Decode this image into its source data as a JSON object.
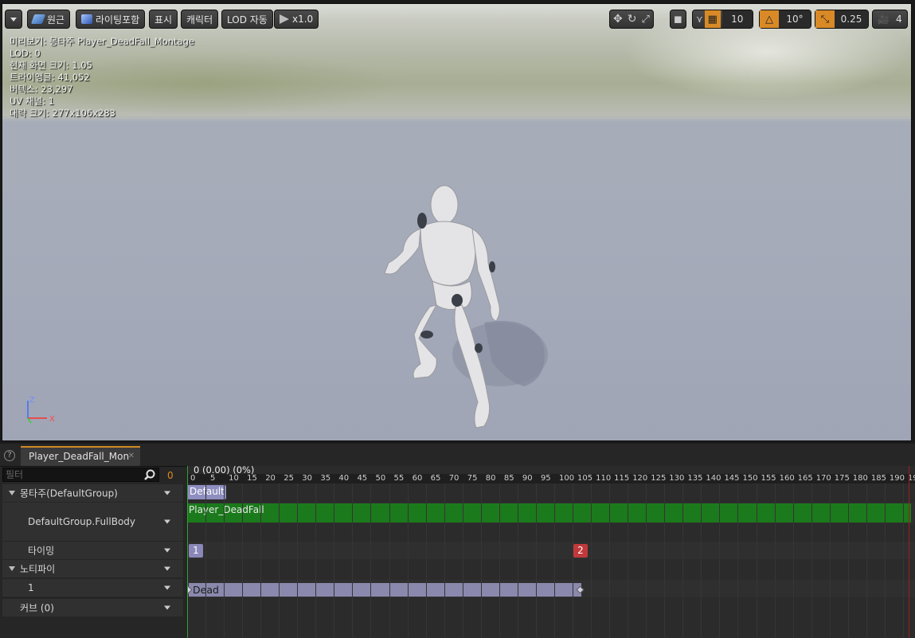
{
  "toolbar": {
    "dropdown_icon": "chevron-down-icon",
    "perspective": "원근",
    "lighting": "라이팅포함",
    "show": "표시",
    "character": "캐릭터",
    "lod": "LOD 자동",
    "speed": "x1.0",
    "grid_snap": "10",
    "rotation_snap": "10°",
    "scale_snap": "0.25",
    "camera_speed": "4",
    "colors": {
      "orange": "#d98a27"
    }
  },
  "stats": {
    "preview": "미리보기: 몽타주 Player_DeadFall_Montage",
    "lod": "LOD: 0",
    "screen_size": "현재 화면 크기: 1.05",
    "triangles": "트라이앵글: 41,052",
    "vertices": "버텍스: 23,297",
    "uv": "UV 채널: 1",
    "bounds": "대략 크기: 277x106x283"
  },
  "axis": {
    "z": "Z",
    "x": "X"
  },
  "panel": {
    "tab_label": "Player_DeadFall_Mon",
    "filter_placeholder": "필터",
    "filter_count": "0",
    "tracks": [
      {
        "label": "몽타주(DefaultGroup)"
      },
      {
        "label": "DefaultGroup.FullBody"
      },
      {
        "label": "타이밍"
      },
      {
        "label": "노티파이"
      },
      {
        "label": "1"
      },
      {
        "label": "커브  (0)"
      }
    ]
  },
  "timeline": {
    "current_time": "0 (0.00) (0%)",
    "ticks": [
      "0",
      "5",
      "10",
      "15",
      "20",
      "25",
      "30",
      "35",
      "40",
      "45",
      "50",
      "55",
      "60",
      "65",
      "70",
      "75",
      "80",
      "85",
      "90",
      "95",
      "100",
      "105",
      "110",
      "115",
      "120",
      "125",
      "130",
      "135",
      "140",
      "145",
      "150",
      "155",
      "160",
      "165",
      "170",
      "175",
      "180",
      "185",
      "190",
      "19"
    ],
    "slot_label": "Default",
    "segment_label": "Player_DeadFall",
    "markers": [
      {
        "label": "1",
        "color": "#8a88b8"
      },
      {
        "label": "2",
        "color": "#c0393b"
      }
    ],
    "notify_label": "Dead",
    "colors": {
      "segment": "#1b7a1b",
      "scrub": "#35a035"
    }
  }
}
